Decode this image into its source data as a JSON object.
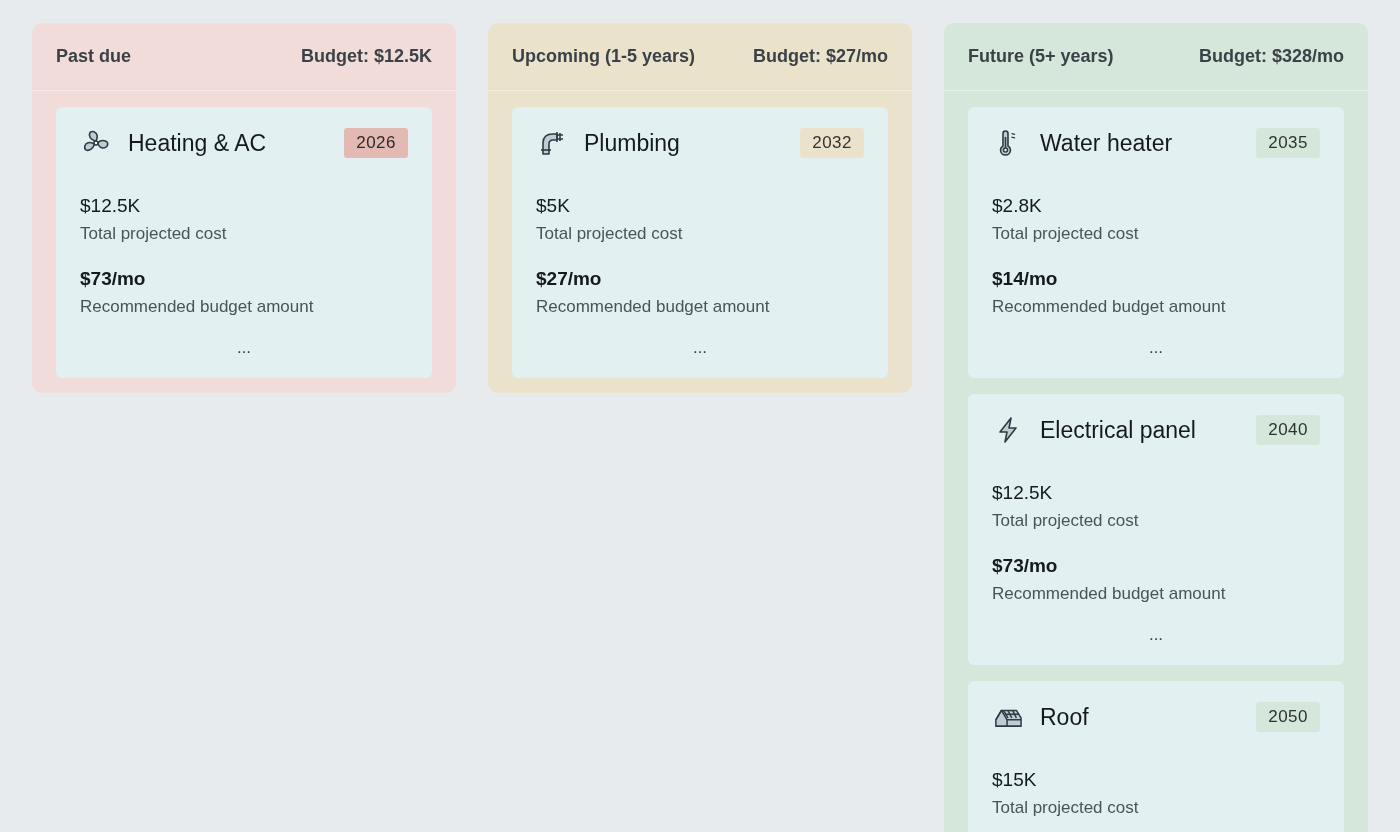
{
  "columns": [
    {
      "title": "Past due",
      "budget": "Budget: $12.5K",
      "color": "#f2dcd9",
      "items": [
        {
          "name": "Heating & AC",
          "year": "2026",
          "color": "#e3b9b4",
          "cost": "$12.5K",
          "cost_label": "Total projected cost",
          "monthly": "$73/mo",
          "monthly_label": "Recommended budget amount",
          "more": "..."
        }
      ]
    },
    {
      "title": "Upcoming (1-5 years)",
      "budget": "Budget: $27/mo",
      "color": "#ebe2cc",
      "items": [
        {
          "name": "Plumbing",
          "year": "2032",
          "color": "#ebe2cc",
          "cost": "$5K",
          "cost_label": "Total projected cost",
          "monthly": "$27/mo",
          "monthly_label": "Recommended budget amount",
          "more": "..."
        }
      ]
    },
    {
      "title": "Future (5+ years)",
      "budget": "Budget: $328/mo",
      "color": "#d5e6da",
      "items": [
        {
          "name": "Water heater",
          "year": "2035",
          "color": "#d5e6da",
          "cost": "$2.8K",
          "cost_label": "Total projected cost",
          "monthly": "$14/mo",
          "monthly_label": "Recommended budget amount",
          "more": "..."
        },
        {
          "name": "Electrical panel",
          "year": "2040",
          "color": "#d5e6da",
          "cost": "$12.5K",
          "cost_label": "Total projected cost",
          "monthly": "$73/mo",
          "monthly_label": "Recommended budget amount",
          "more": "..."
        },
        {
          "name": "Roof",
          "year": "2050",
          "color": "#d5e6da",
          "cost": "$15K",
          "cost_label": "Total projected cost"
        }
      ]
    }
  ]
}
